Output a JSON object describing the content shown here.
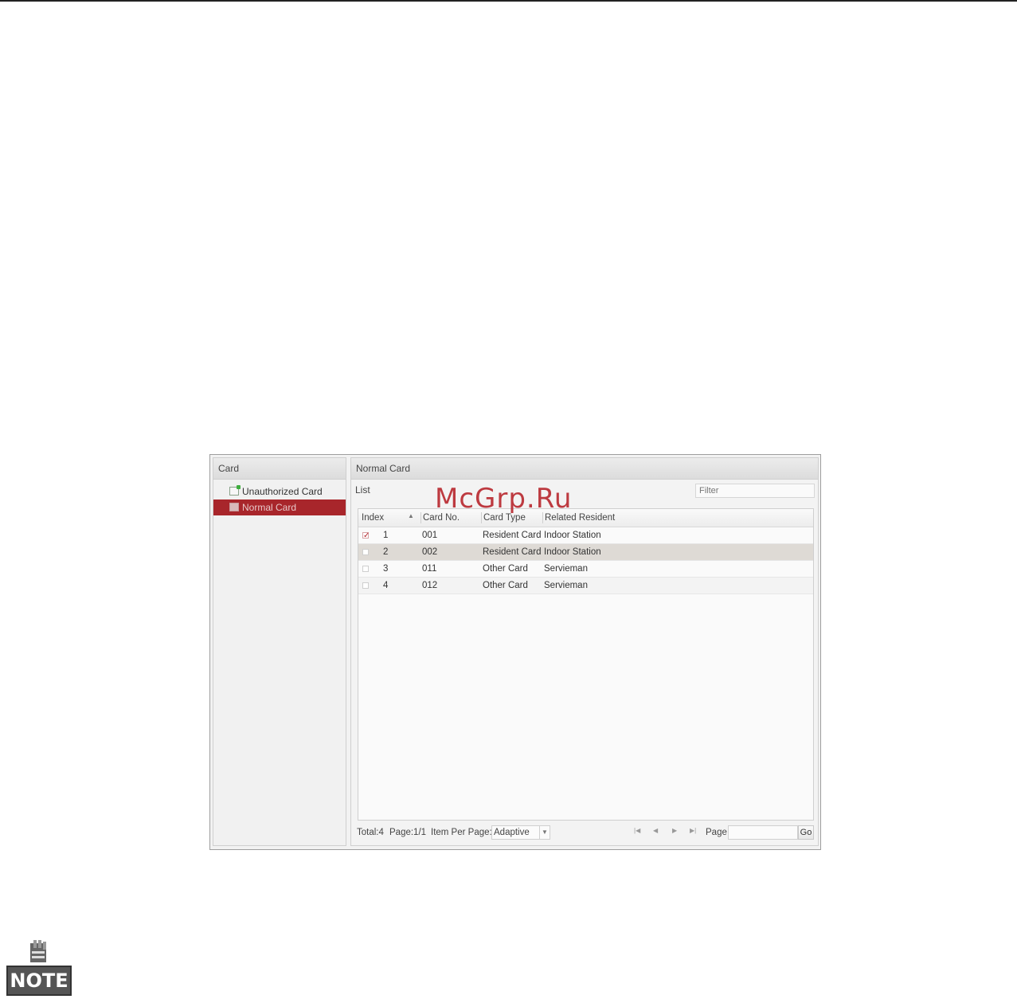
{
  "left_panel": {
    "title": "Card",
    "items": [
      {
        "label": "Unauthorized Card",
        "icon": "add-card-icon",
        "selected": false
      },
      {
        "label": "Normal Card",
        "icon": "card-icon",
        "selected": true
      }
    ]
  },
  "right_panel": {
    "title": "Normal Card",
    "list_label": "List",
    "filter_placeholder": "Filter",
    "columns": [
      "Index",
      "Card No.",
      "Card Type",
      "Related Resident"
    ],
    "rows": [
      {
        "checked": true,
        "index": "1",
        "card_no": "001",
        "card_type": "Resident Card",
        "related_resident": "Indoor Station"
      },
      {
        "checked": false,
        "index": "2",
        "card_no": "002",
        "card_type": "Resident Card",
        "related_resident": "Indoor Station"
      },
      {
        "checked": false,
        "index": "3",
        "card_no": "011",
        "card_type": "Other Card",
        "related_resident": "Servieman"
      },
      {
        "checked": false,
        "index": "4",
        "card_no": "012",
        "card_type": "Other Card",
        "related_resident": "Servieman"
      }
    ],
    "footer": {
      "total": "Total:4",
      "page": "Page:1/1",
      "item_per_page_label": "Item Per Page:",
      "item_per_page_value": "Adaptive",
      "page_label": "Page",
      "go_label": "Go"
    }
  },
  "watermark": "McGrp.Ru",
  "note": {
    "label": "NOTE"
  },
  "colors": {
    "selected_item": "#a8262b",
    "highlight_row": "#dedad5",
    "watermark": "#b8272d"
  }
}
